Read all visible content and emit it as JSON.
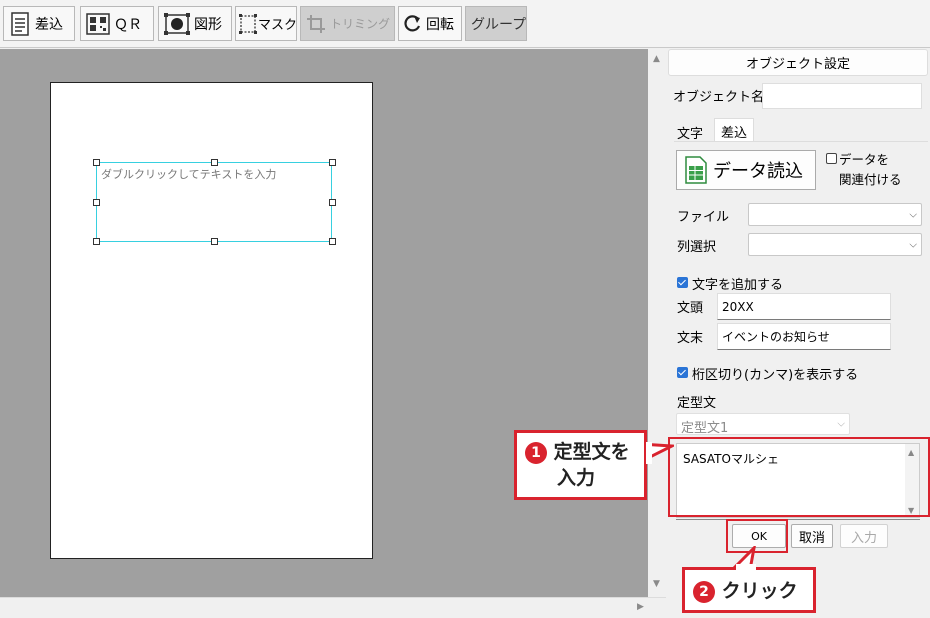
{
  "toolbar": {
    "merge": "差込",
    "qr": "ＱＲ",
    "shape": "図形",
    "mask": "マスク",
    "trimming": "トリミング",
    "rotate": "回転",
    "group": "グループ"
  },
  "canvas": {
    "textbox_placeholder": "ダブルクリックしてテキストを入力"
  },
  "panel": {
    "title": "オブジェクト設定",
    "object_name_label": "オブジェクト名",
    "object_name_value": "",
    "tabs": [
      "文字",
      "差込"
    ],
    "active_tab": "差込",
    "data_load_button": "データ読込",
    "link_data_label_1": "データを",
    "link_data_label_2": "関連付ける",
    "link_data_checked": false,
    "file_label": "ファイル",
    "file_value": "",
    "column_label": "列選択",
    "column_value": "",
    "add_text_label": "文字を追加する",
    "add_text_checked": true,
    "prefix_label": "文頭",
    "prefix_value": "20XX",
    "suffix_label": "文末",
    "suffix_value": "イベントのお知らせ",
    "comma_label": "桁区切り(カンマ)を表示する",
    "comma_checked": true,
    "template_label": "定型文",
    "template_select": "定型文1",
    "template_text": "SASATOマルシェ",
    "ok_button": "OK",
    "cancel_button": "取消",
    "input_button": "入力"
  },
  "annotations": {
    "step1_number": "1",
    "step1_line1": "定型文を",
    "step1_line2": "入力",
    "step2_number": "2",
    "step2_text": "クリック",
    "accent_color": "#d9232e"
  },
  "icons": [
    "document-icon",
    "qr-icon",
    "shape-icon",
    "mask-icon",
    "crop-icon",
    "rotate-icon",
    "spreadsheet-icon",
    "chevron-down-icon"
  ]
}
